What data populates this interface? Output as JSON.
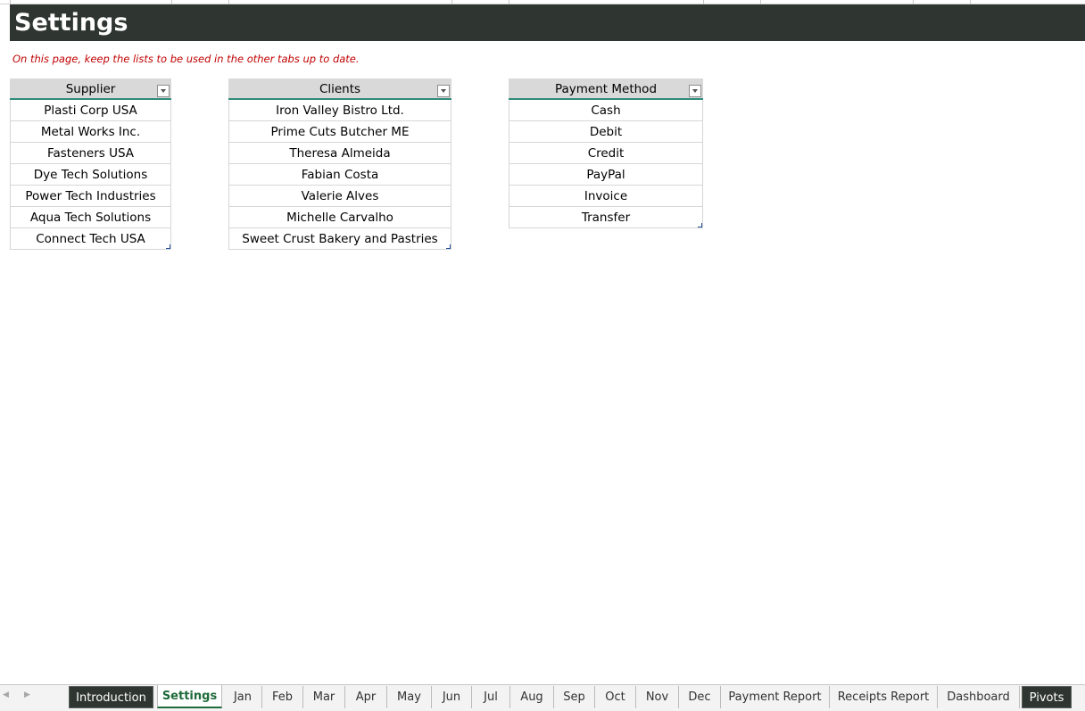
{
  "sheet": {
    "title": "Settings",
    "note": "On this page, keep the lists to be used in the other tabs up to date."
  },
  "tables": {
    "supplier": {
      "header": "Supplier",
      "rows": [
        "Plasti Corp USA",
        "Metal Works Inc.",
        "Fasteners USA",
        "Dye Tech Solutions",
        "Power Tech Industries",
        "Aqua Tech Solutions",
        "Connect Tech USA"
      ]
    },
    "clients": {
      "header": "Clients",
      "rows": [
        "Iron Valley Bistro Ltd.",
        "Prime Cuts Butcher ME",
        "Theresa Almeida",
        "Fabian Costa",
        "Valerie Alves",
        "Michelle Carvalho",
        "Sweet Crust Bakery and Pastries"
      ]
    },
    "payment": {
      "header": "Payment Method",
      "rows": [
        "Cash",
        "Debit",
        "Credit",
        "PayPal",
        "Invoice",
        "Transfer"
      ]
    }
  },
  "tabs": [
    "Introduction",
    "Settings",
    "Jan",
    "Feb",
    "Mar",
    "Apr",
    "May",
    "Jun",
    "Jul",
    "Aug",
    "Sep",
    "Oct",
    "Nov",
    "Dec",
    "Payment Report",
    "Receipts Report",
    "Dashboard",
    "Pivots"
  ],
  "nav": {
    "prev": "◀",
    "next": "▶"
  },
  "colors": {
    "title_bg": "#2f3632",
    "note_text": "#c00000",
    "table_header_bg": "#d9d9d9",
    "table_accent": "#2e8b7a",
    "active_tab_text": "#1e6b3a"
  },
  "icons": {
    "filter": "filter-dropdown-icon",
    "resize": "table-resize-handle-icon"
  }
}
